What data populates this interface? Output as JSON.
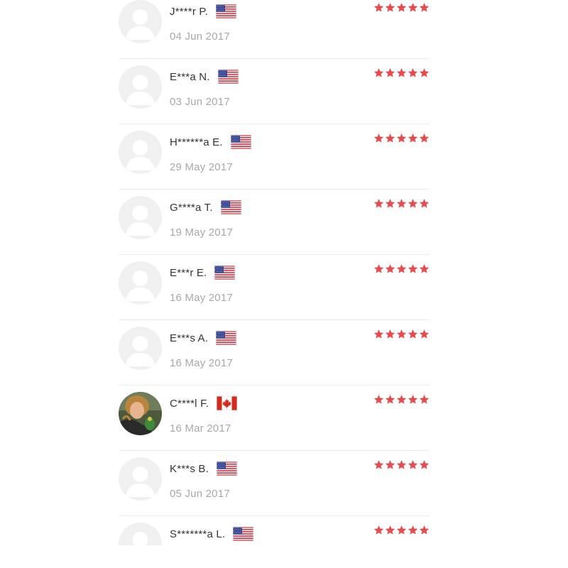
{
  "colors": {
    "star": "#e74c4c",
    "name": "#333333",
    "date": "#a8a8a8",
    "divider": "#ececec",
    "avatar_placeholder": "#f0f0f0"
  },
  "reviews": [
    {
      "name": "J****r P.",
      "flag": "us-flag-icon",
      "date": "04 Jun 2017",
      "rating": 5,
      "avatar": "default-avatar"
    },
    {
      "name": "E***a N.",
      "flag": "us-flag-icon",
      "date": "03 Jun 2017",
      "rating": 5,
      "avatar": "default-avatar"
    },
    {
      "name": "H******a E.",
      "flag": "us-flag-icon",
      "date": "29 May 2017",
      "rating": 5,
      "avatar": "default-avatar"
    },
    {
      "name": "G****a T.",
      "flag": "us-flag-icon",
      "date": "19 May 2017",
      "rating": 5,
      "avatar": "default-avatar"
    },
    {
      "name": "E***r E.",
      "flag": "us-flag-icon",
      "date": "16 May 2017",
      "rating": 5,
      "avatar": "default-avatar"
    },
    {
      "name": "E***s A.",
      "flag": "us-flag-icon",
      "date": "16 May 2017",
      "rating": 5,
      "avatar": "default-avatar"
    },
    {
      "name": "C****l F.",
      "flag": "canada-flag-icon",
      "date": "16 Mar 2017",
      "rating": 5,
      "avatar": "user-photo"
    },
    {
      "name": "K***s B.",
      "flag": "us-flag-icon",
      "date": "05 Jun 2017",
      "rating": 5,
      "avatar": "default-avatar"
    },
    {
      "name": "S*******a L.",
      "flag": "us-flag-icon",
      "date": "",
      "rating": 5,
      "avatar": "default-avatar"
    }
  ]
}
